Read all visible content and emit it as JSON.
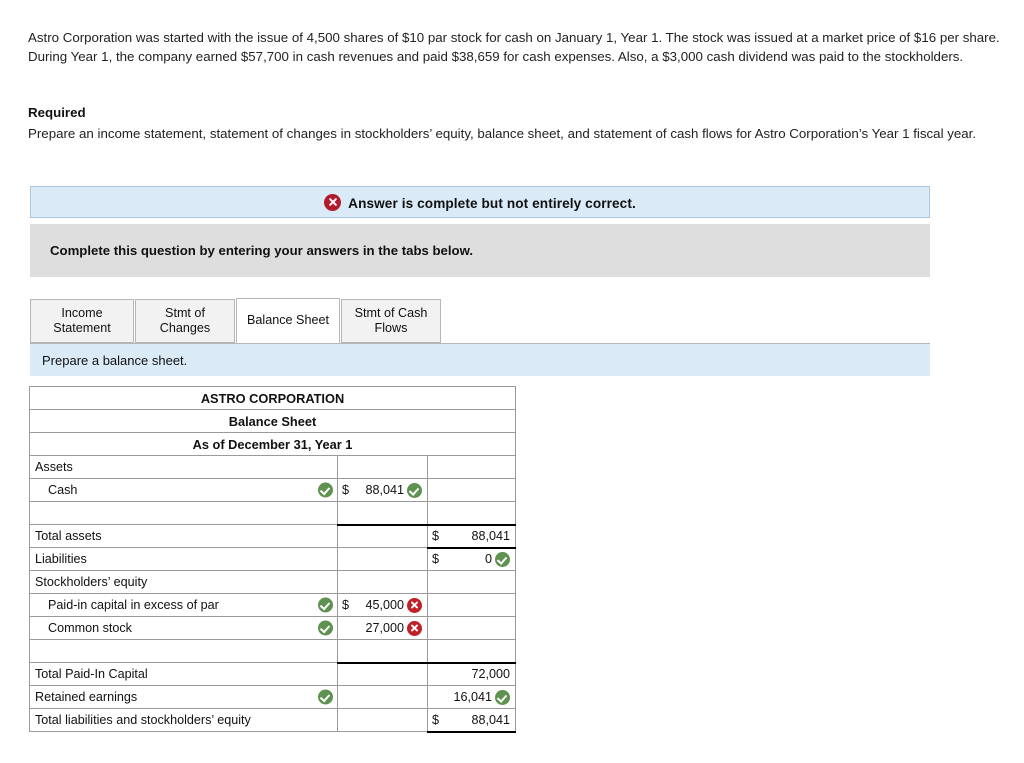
{
  "problem": {
    "paragraph": "Astro Corporation was started with the issue of 4,500 shares of $10 par stock for cash on January 1, Year 1. The stock was issued at a market price of $16 per share. During Year 1, the company earned $57,700 in cash revenues and paid $38,659 for cash expenses. Also, a $3,000 cash dividend was paid to the stockholders.",
    "required_label": "Required",
    "required_text": "Prepare an income statement, statement of changes in stockholders’ equity, balance sheet, and statement of cash flows for Astro Corporation’s Year 1 fiscal year."
  },
  "alert": {
    "icon": "error-x-icon",
    "text": "Answer is complete but not entirely correct."
  },
  "instruction": {
    "text": "Complete this question by entering your answers in the tabs below."
  },
  "tabs": [
    {
      "label": "Income Statement",
      "active": false
    },
    {
      "label": "Stmt of Changes",
      "active": false
    },
    {
      "label": "Balance Sheet",
      "active": true
    },
    {
      "label": "Stmt of Cash Flows",
      "active": false
    }
  ],
  "prepare": {
    "text": "Prepare a balance sheet."
  },
  "balance_sheet": {
    "titles": [
      "ASTRO CORPORATION",
      "Balance Sheet",
      "As of December 31, Year 1"
    ],
    "rows": [
      {
        "label": "Assets",
        "label_mark": "",
        "col2": "",
        "col2_dollar": "",
        "col2_mark": "",
        "col3": "",
        "col3_dollar": "",
        "col3_mark": ""
      },
      {
        "label": "Cash",
        "label_mark": "ok",
        "col2": "88,041",
        "col2_dollar": "$",
        "col2_mark": "ok",
        "col3": "",
        "col3_dollar": "",
        "col3_mark": ""
      },
      {
        "label": "",
        "label_mark": "",
        "col2": "",
        "col2_dollar": "",
        "col2_mark": "",
        "col3": "",
        "col3_dollar": "",
        "col3_mark": ""
      },
      {
        "label": "Total assets",
        "label_mark": "",
        "col2": "",
        "col2_dollar": "",
        "col2_mark": "",
        "col3": "88,041",
        "col3_dollar": "$",
        "col3_mark": ""
      },
      {
        "label": "Liabilities",
        "label_mark": "",
        "col2": "",
        "col2_dollar": "",
        "col2_mark": "",
        "col3": "0",
        "col3_dollar": "$",
        "col3_mark": "ok"
      },
      {
        "label": "Stockholders’ equity",
        "label_mark": "",
        "col2": "",
        "col2_dollar": "",
        "col2_mark": "",
        "col3": "",
        "col3_dollar": "",
        "col3_mark": ""
      },
      {
        "label": "Paid-in capital in excess of par",
        "label_mark": "ok",
        "col2": "45,000",
        "col2_dollar": "$",
        "col2_mark": "bad",
        "col3": "",
        "col3_dollar": "",
        "col3_mark": ""
      },
      {
        "label": "Common stock",
        "label_mark": "ok",
        "col2": "27,000",
        "col2_dollar": "",
        "col2_mark": "bad",
        "col3": "",
        "col3_dollar": "",
        "col3_mark": ""
      },
      {
        "label": "",
        "label_mark": "",
        "col2": "",
        "col2_dollar": "",
        "col2_mark": "",
        "col3": "",
        "col3_dollar": "",
        "col3_mark": ""
      },
      {
        "label": "Total Paid-In Capital",
        "label_mark": "",
        "col2": "",
        "col2_dollar": "",
        "col2_mark": "",
        "col3": "72,000",
        "col3_dollar": "",
        "col3_mark": ""
      },
      {
        "label": "Retained earnings",
        "label_mark": "ok",
        "col2": "",
        "col2_dollar": "",
        "col2_mark": "",
        "col3": "16,041",
        "col3_dollar": "",
        "col3_mark": "ok"
      },
      {
        "label": "Total liabilities and stockholders’ equity",
        "label_mark": "",
        "col2": "",
        "col2_dollar": "",
        "col2_mark": "",
        "col3": "88,041",
        "col3_dollar": "$",
        "col3_mark": ""
      }
    ]
  },
  "colors": {
    "header_blue": "#85abdd",
    "banner_blue": "#daeaf7",
    "instruction_gray": "#dedede",
    "correct_green": "#5f9150",
    "incorrect_red": "#bf2128"
  }
}
